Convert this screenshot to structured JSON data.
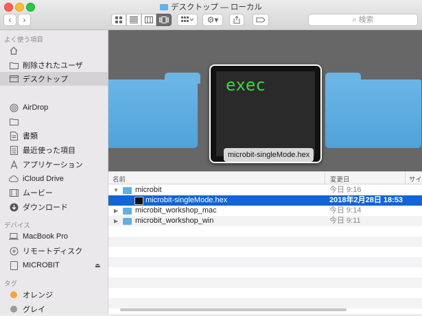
{
  "window": {
    "title": "デスクトップ — ローカル",
    "search_placeholder": "検索"
  },
  "toolbar": {
    "back_glyph": "‹",
    "forward_glyph": "›",
    "view_icons": [
      "icon-view-icon",
      "list-view-icon",
      "column-view-icon",
      "coverflow-view-icon"
    ],
    "selected_view": "coverflow"
  },
  "sidebar": {
    "favorites_header": "よく使う項目",
    "favorites": [
      {
        "label": "",
        "icon": "home-icon"
      },
      {
        "label": "削除されたユーザ",
        "icon": "folder-icon"
      },
      {
        "label": "デスクトップ",
        "icon": "desktop-icon",
        "active": true
      },
      {
        "label": "",
        "icon": "blank"
      },
      {
        "label": "AirDrop",
        "icon": "airdrop-icon"
      },
      {
        "label": "",
        "icon": "folder-icon"
      },
      {
        "label": "書類",
        "icon": "documents-icon"
      },
      {
        "label": "最近使った項目",
        "icon": "recents-icon"
      },
      {
        "label": "アプリケーション",
        "icon": "applications-icon"
      },
      {
        "label": "iCloud Drive",
        "icon": "cloud-icon"
      },
      {
        "label": "ムービー",
        "icon": "movies-icon"
      },
      {
        "label": "ダウンロード",
        "icon": "downloads-icon"
      }
    ],
    "devices_header": "デバイス",
    "devices": [
      {
        "label": "MacBook Pro",
        "icon": "laptop-icon"
      },
      {
        "label": "リモートディスク",
        "icon": "disc-icon"
      },
      {
        "label": "MICROBIT",
        "icon": "drive-icon"
      }
    ],
    "tags_header": "タグ",
    "tags": [
      {
        "label": "オレンジ",
        "color": "#f5a33b"
      },
      {
        "label": "グレイ",
        "color": "#9a9a9a"
      }
    ]
  },
  "coverflow": {
    "tile_text": "exec",
    "caption": "microbit-singleMode.hex"
  },
  "list": {
    "columns": [
      "名前",
      "変更日",
      "サイ"
    ],
    "rows": [
      {
        "name": "microbit",
        "date": "今日 9:16",
        "type": "folder",
        "expanded": true,
        "level": 0
      },
      {
        "name": "microbit-singleMode.hex",
        "date": "2018年2月28日 18:53",
        "type": "hex",
        "level": 1,
        "selected": true
      },
      {
        "name": "microbit_workshop_mac",
        "date": "今日 9:14",
        "type": "folder",
        "expanded": false,
        "level": 0
      },
      {
        "name": "microbit_workshop_win",
        "date": "今日 9:11",
        "type": "folder",
        "expanded": false,
        "level": 0
      }
    ]
  }
}
